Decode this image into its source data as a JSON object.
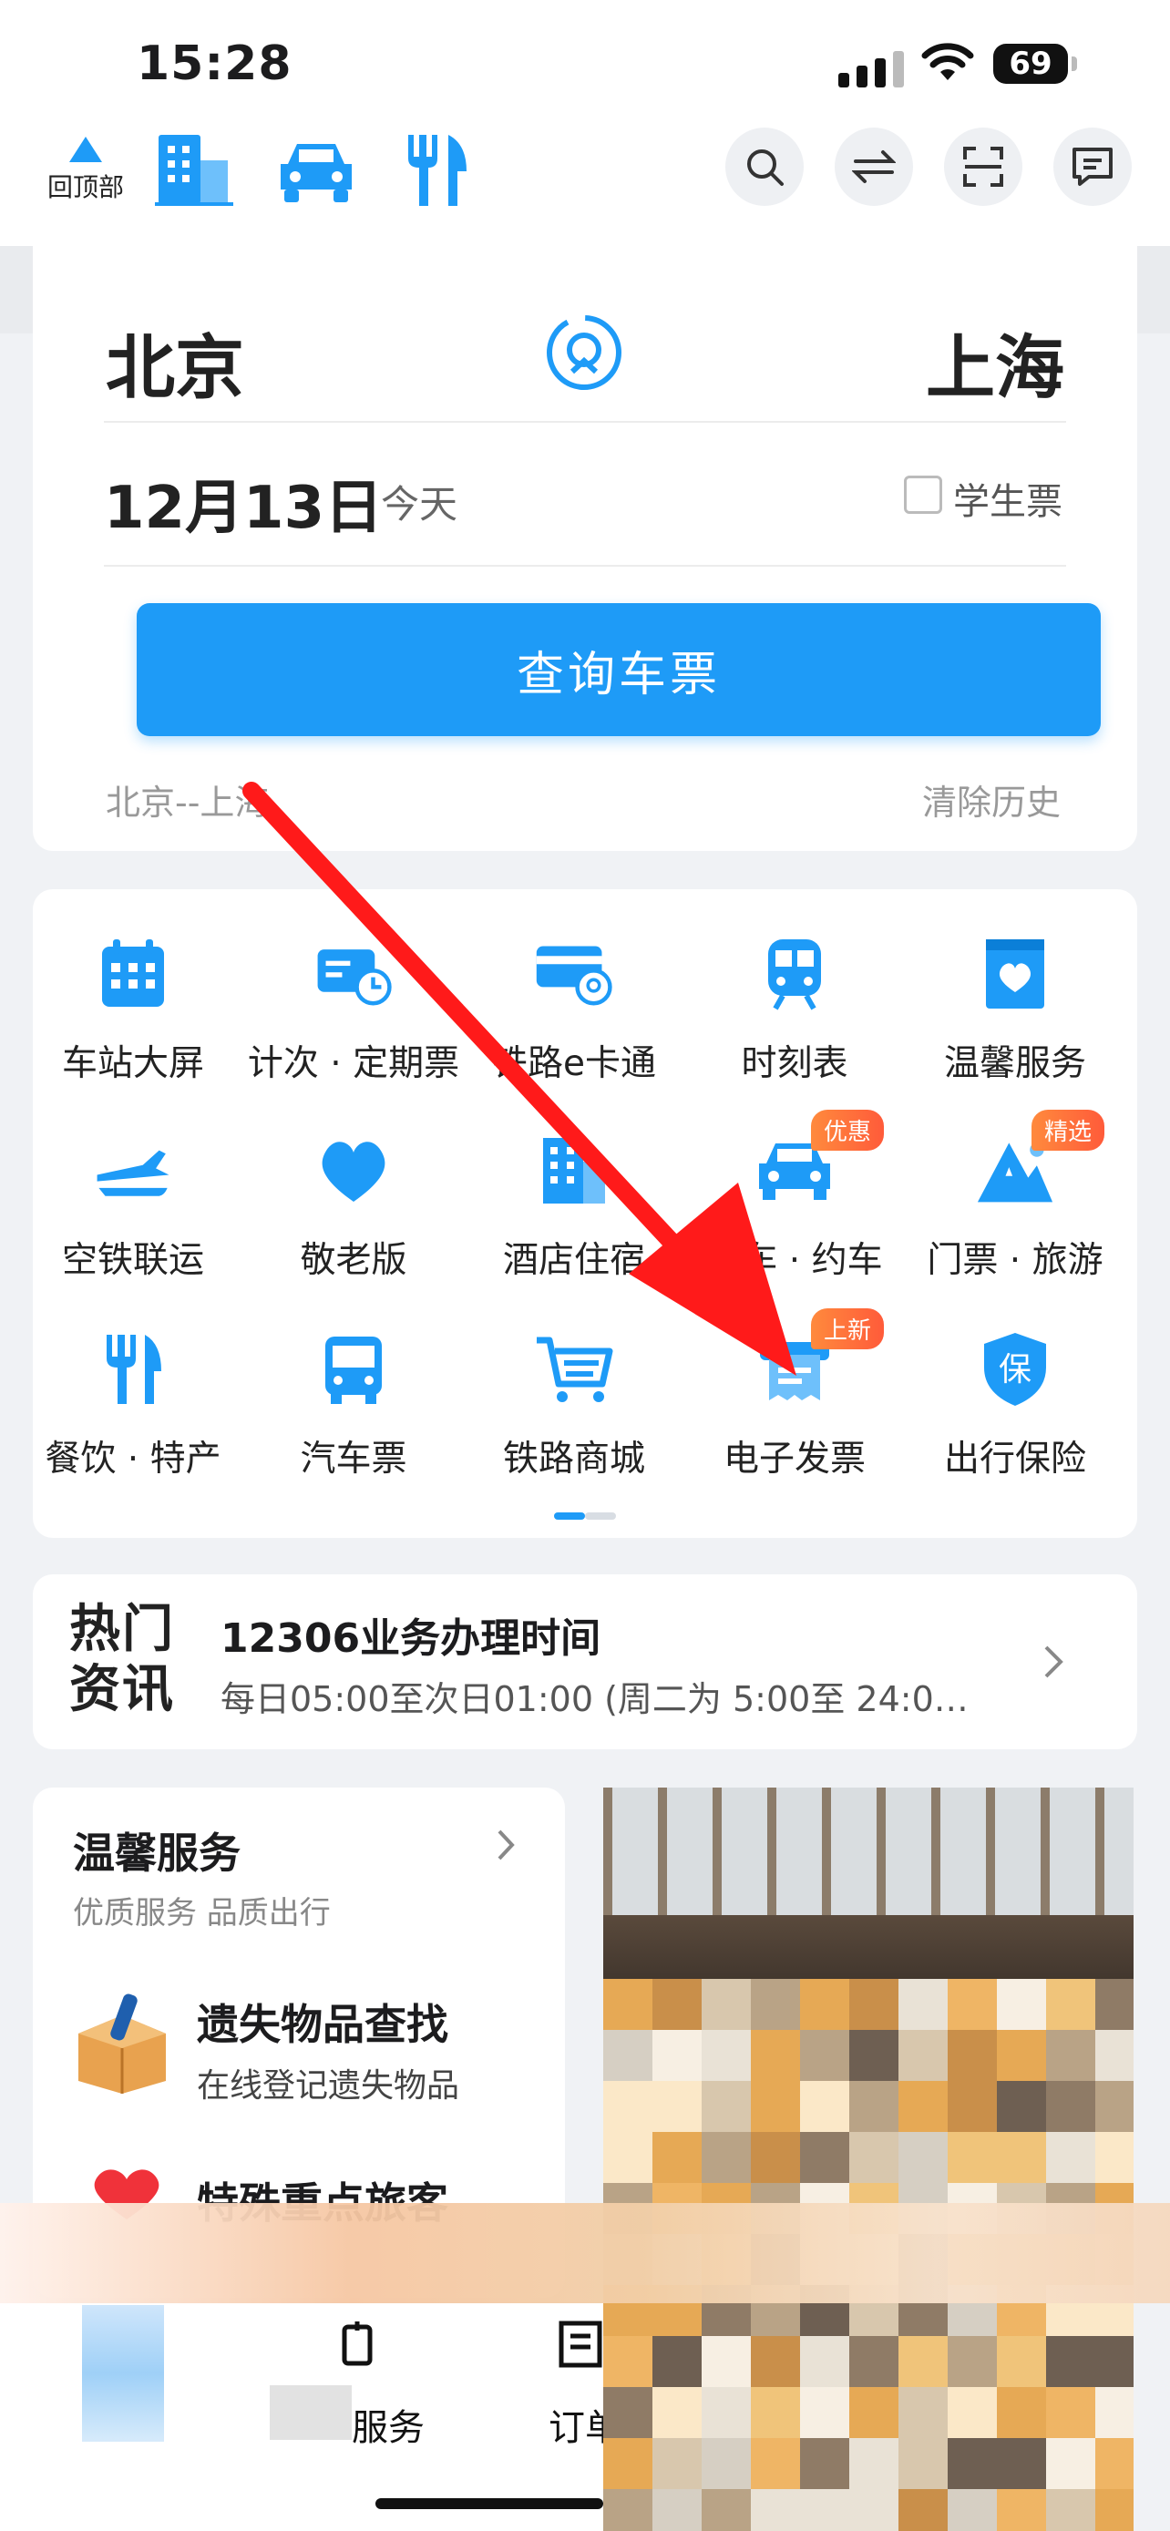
{
  "status": {
    "time": "15:28",
    "battery": "69"
  },
  "nav": {
    "back_top_label": "回顶部"
  },
  "search": {
    "from": "北京",
    "to": "上海",
    "date": "12月13日",
    "day": "今天",
    "student_label": "学生票",
    "query_label": "查询车票",
    "history": "北京--上海",
    "clear_history": "清除历史"
  },
  "services": [
    {
      "label": "车站大屏",
      "icon": "calendar-icon"
    },
    {
      "label": "计次 · 定期票",
      "icon": "ticket-clock-icon"
    },
    {
      "label": "铁路e卡通",
      "icon": "rail-card-icon"
    },
    {
      "label": "时刻表",
      "icon": "train-icon"
    },
    {
      "label": "温馨服务",
      "icon": "heart-bag-icon"
    },
    {
      "label": "空铁联运",
      "icon": "plane-train-icon"
    },
    {
      "label": "敬老版",
      "icon": "heart-icon"
    },
    {
      "label": "酒店住宿",
      "icon": "hotel-icon"
    },
    {
      "label": "租车 · 约车",
      "icon": "car-icon",
      "badge": "优惠"
    },
    {
      "label": "门票 · 旅游",
      "icon": "mountain-icon",
      "badge": "精选"
    },
    {
      "label": "餐饮 · 特产",
      "icon": "fork-knife-icon"
    },
    {
      "label": "汽车票",
      "icon": "bus-icon"
    },
    {
      "label": "铁路商城",
      "icon": "cart-icon"
    },
    {
      "label": "电子发票",
      "icon": "invoice-icon",
      "badge": "上新"
    },
    {
      "label": "出行保险",
      "icon": "shield-icon"
    }
  ],
  "news": {
    "tag_top": "热门",
    "tag_bottom": "资讯",
    "title": "12306业务办理时间",
    "subtitle": "每日05:00至次日01:00 (周二为 5:00至 24:0…"
  },
  "warm": {
    "title": "温馨服务",
    "subtitle": "优质服务 品质出行",
    "item1_title": "遗失物品查找",
    "item1_sub": "在线登记遗失物品",
    "item2_title": "特殊重点旅客"
  },
  "tabbar": {
    "service": "服务",
    "orders": "订单"
  },
  "colors": {
    "accent": "#1e9bf7",
    "arrow": "#ff1a1a",
    "badge": "#ff6a3c"
  }
}
